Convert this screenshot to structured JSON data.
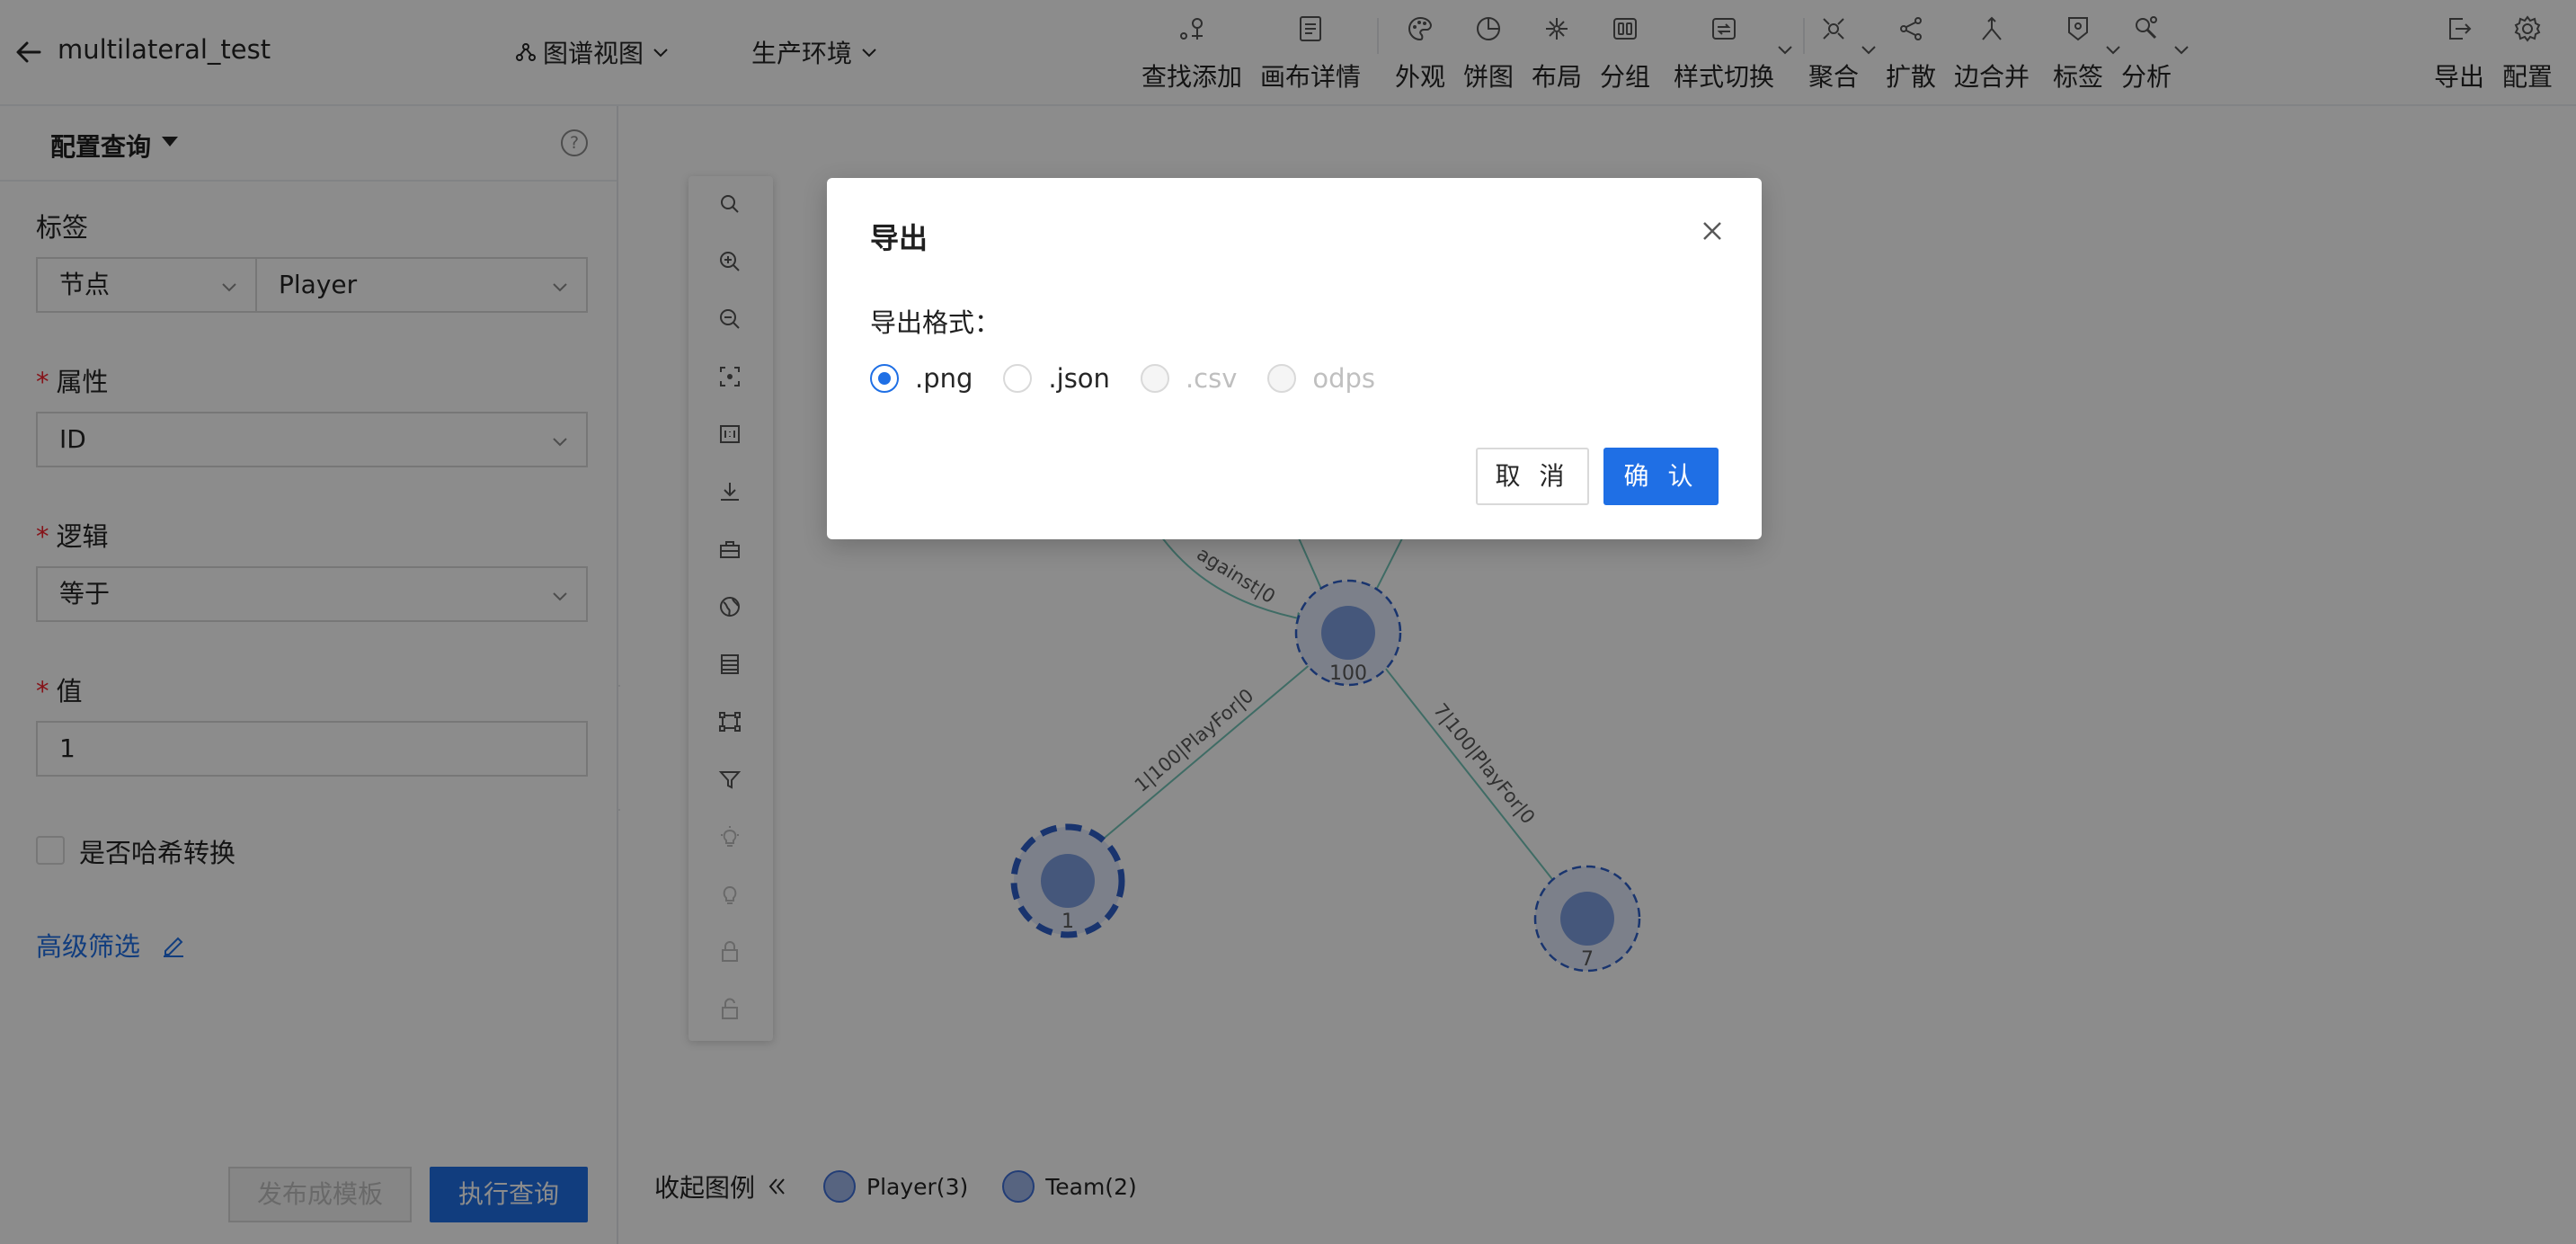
{
  "header": {
    "title": "multilateral_test",
    "view_dropdown": "图谱视图",
    "env_dropdown": "生产环境",
    "tools": [
      {
        "label": "查找添加",
        "icon": "find-add-icon"
      },
      {
        "label": "画布详情",
        "icon": "canvas-details-icon"
      },
      {
        "label": "外观",
        "icon": "appearance-icon"
      },
      {
        "label": "饼图",
        "icon": "pie-chart-icon"
      },
      {
        "label": "布局",
        "icon": "layout-icon"
      },
      {
        "label": "分组",
        "icon": "group-icon"
      },
      {
        "label": "样式切换",
        "icon": "style-switch-icon"
      },
      {
        "label": "聚合",
        "icon": "aggregate-icon"
      },
      {
        "label": "扩散",
        "icon": "expand-icon"
      },
      {
        "label": "边合并",
        "icon": "edge-merge-icon"
      },
      {
        "label": "标签",
        "icon": "tag-icon"
      },
      {
        "label": "分析",
        "icon": "analysis-icon"
      },
      {
        "label": "导出",
        "icon": "export-icon"
      },
      {
        "label": "配置",
        "icon": "settings-icon"
      }
    ]
  },
  "panel": {
    "title": "配置查询",
    "label_field": {
      "label": "标签",
      "type_value": "节点",
      "value": "Player"
    },
    "attr_field": {
      "label": "属性",
      "value": "ID"
    },
    "logic_field": {
      "label": "逻辑",
      "value": "等于"
    },
    "value_field": {
      "label": "值",
      "value": "1"
    },
    "hash_checkbox": {
      "label": "是否哈希转换",
      "checked": false
    },
    "advanced_filter": "高级筛选",
    "publish_button": "发布成模板",
    "run_button": "执行查询"
  },
  "vertical_toolbar": [
    "search-icon",
    "zoom-in-icon",
    "zoom-out-icon",
    "fit-view-icon",
    "real-size-icon",
    "download-icon",
    "toolbox-icon",
    "globe-icon",
    "list-icon",
    "select-area-icon",
    "filter-icon",
    "bulb-icon",
    "bulb-outline-icon",
    "lock-icon",
    "unlock-icon"
  ],
  "graph": {
    "nodes": [
      {
        "id": "100",
        "label": "100"
      },
      {
        "id": "1",
        "label": "1"
      },
      {
        "id": "7",
        "label": "7"
      }
    ],
    "edges": [
      {
        "label": "1|100|PlayFor|0"
      },
      {
        "label": "7|100|PlayFor|0"
      },
      {
        "label": "against|0"
      }
    ],
    "legend": {
      "toggle_label": "收起图例",
      "items": [
        {
          "label": "Player(3)"
        },
        {
          "label": "Team(2)"
        }
      ]
    }
  },
  "modal": {
    "title": "导出",
    "format_label": "导出格式：",
    "options": [
      {
        "label": ".png",
        "checked": true,
        "disabled": false
      },
      {
        "label": ".json",
        "checked": false,
        "disabled": false
      },
      {
        "label": ".csv",
        "checked": false,
        "disabled": true
      },
      {
        "label": "odps",
        "checked": false,
        "disabled": true
      }
    ],
    "cancel": "取 消",
    "ok": "确 认"
  },
  "colors": {
    "primary": "#1f6fe5",
    "node_fill": "#7f9ee0",
    "edge": "#74c5b8"
  }
}
